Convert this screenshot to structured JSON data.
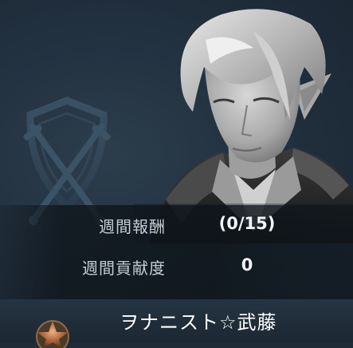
{
  "stats": {
    "weekly_reward_label": "週間報酬",
    "weekly_reward_value": "(0/15)",
    "weekly_contribution_label": "週間貢献度",
    "weekly_contribution_value": "0"
  },
  "player": {
    "name": "ヲナニスト☆武藤"
  },
  "icons": {
    "emblem": "crossed-swords-shield-icon",
    "portrait": "elf-character-portrait",
    "rank": "star-rank-badge-icon"
  },
  "colors": {
    "background": "#1f2b36",
    "label": "#c3ccd4",
    "value": "#f2f4f6",
    "name": "#ffffff"
  }
}
